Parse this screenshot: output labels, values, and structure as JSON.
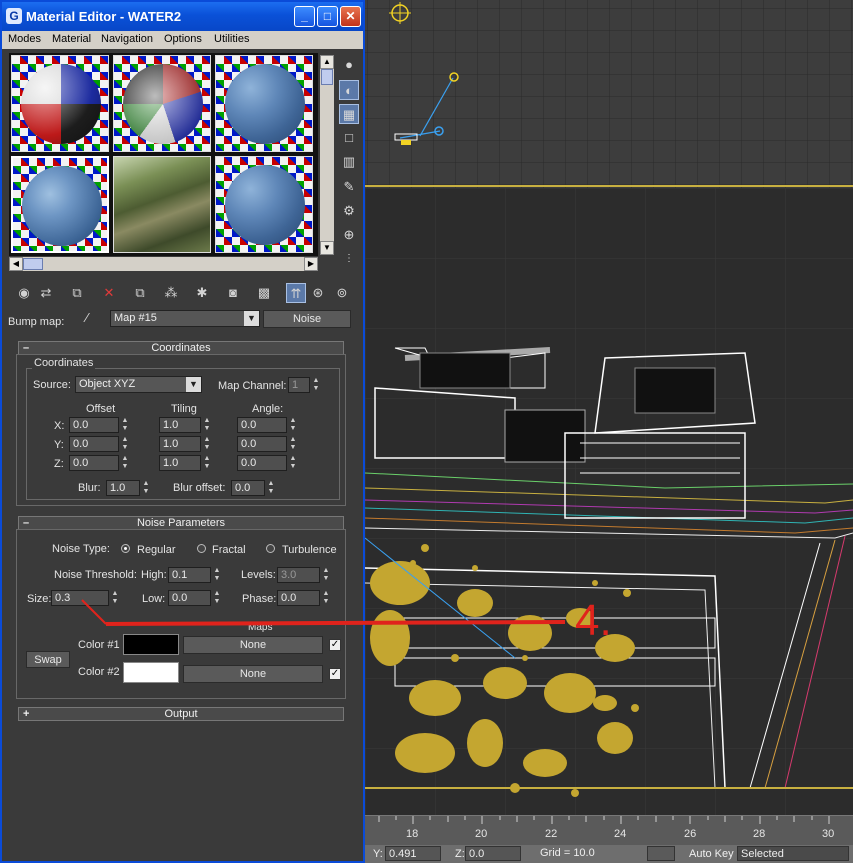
{
  "window": {
    "title": "Material Editor - WATER2",
    "icon_letter": "G"
  },
  "menu": [
    "Modes",
    "Material",
    "Navigation",
    "Options",
    "Utilities"
  ],
  "bump": {
    "label": "Bump map:",
    "map_name": "Map #15",
    "type_button": "Noise"
  },
  "coordinates": {
    "rollout_title": "Coordinates",
    "group_label": "Coordinates",
    "source_label": "Source:",
    "source_value": "Object XYZ",
    "map_channel_label": "Map Channel:",
    "map_channel_value": "1",
    "offset_label": "Offset",
    "tiling_label": "Tiling",
    "angle_label": "Angle:",
    "axes": [
      "X:",
      "Y:",
      "Z:"
    ],
    "offset": [
      "0.0",
      "0.0",
      "0.0"
    ],
    "tiling": [
      "1.0",
      "1.0",
      "1.0"
    ],
    "angle": [
      "0.0",
      "0.0",
      "0.0"
    ],
    "blur_label": "Blur:",
    "blur_value": "1.0",
    "blur_offset_label": "Blur offset:",
    "blur_offset_value": "0.0"
  },
  "noise": {
    "rollout_title": "Noise Parameters",
    "type_label": "Noise Type:",
    "types": [
      "Regular",
      "Fractal",
      "Turbulence"
    ],
    "selected_type": "Regular",
    "threshold_label": "Noise Threshold:",
    "high_label": "High:",
    "high_value": "0.1",
    "levels_label": "Levels:",
    "levels_value": "3.0",
    "size_label": "Size:",
    "size_value": "0.3",
    "low_label": "Low:",
    "low_value": "0.0",
    "phase_label": "Phase:",
    "phase_value": "0.0",
    "maps_label": "Maps",
    "swap_label": "Swap",
    "color1_label": "Color #1",
    "color1": "#000000",
    "color1_map": "None",
    "color2_label": "Color #2",
    "color2": "#ffffff",
    "color2_map": "None"
  },
  "output": {
    "rollout_title": "Output"
  },
  "annotation": {
    "text": "4.",
    "color": "#e0231c"
  },
  "timeline": {
    "ticks": [
      "18",
      "20",
      "22",
      "24",
      "26",
      "28",
      "30"
    ]
  },
  "statusbar": {
    "y_label": "Y:",
    "y_value": "0.491",
    "z_label": "Z:",
    "z_value": "0.0",
    "grid": "Grid = 10.0",
    "autokey": "Auto Key",
    "selected": "Selected"
  }
}
